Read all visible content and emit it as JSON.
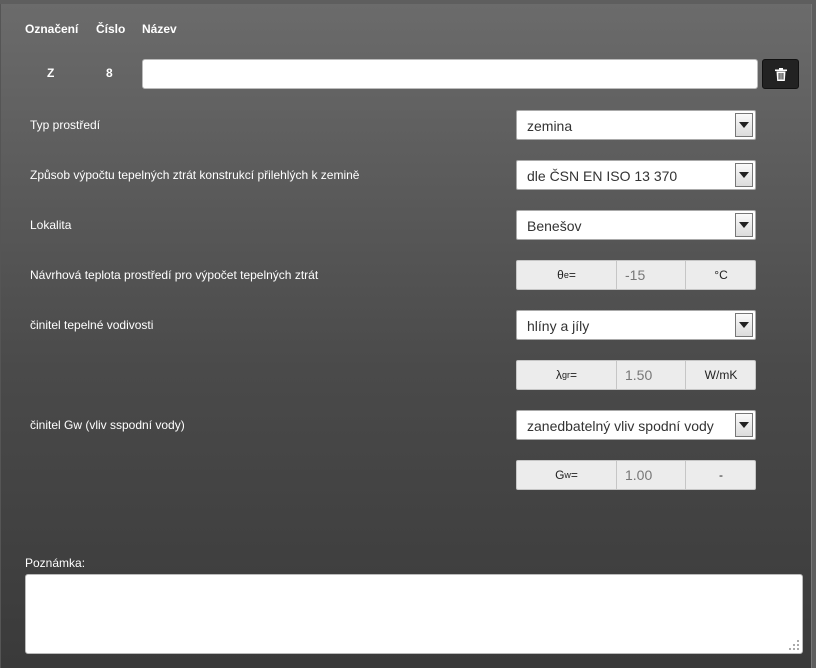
{
  "header": {
    "oznaceni": "Označení",
    "cislo": "Číslo",
    "nazev": "Název"
  },
  "row": {
    "oznaceni": "Z",
    "cislo": "8",
    "name_value": ""
  },
  "fields": {
    "typ_prostredi": {
      "label": "Typ prostředí",
      "value": "zemina"
    },
    "zpusob": {
      "label": "Způsob výpočtu tepelných ztrát konstrukcí přilehlých k zemině",
      "value": "dle ČSN EN ISO 13 370"
    },
    "lokalita": {
      "label": "Lokalita",
      "value": "Benešov"
    },
    "teplota": {
      "label": "Návrhová teplota prostředí pro výpočet tepelných ztrát",
      "symbol": "θ",
      "symbol_sub": "e",
      "symbol_eq": "=",
      "value": "-15",
      "unit": "°C"
    },
    "vodivost": {
      "label": "činitel tepelné vodivosti",
      "value": "hlíny a jíly"
    },
    "lambda": {
      "symbol": "λ",
      "symbol_sub": "gr",
      "symbol_eq": "=",
      "value": "1.50",
      "unit": "W/mK"
    },
    "gw": {
      "label": "činitel Gw (vliv sspodní vody)",
      "value": "zanedbatelný vliv spodní vody"
    },
    "gw_value": {
      "symbol": "G",
      "symbol_sub": "w",
      "symbol_eq": "=",
      "value": "1.00",
      "unit": "-"
    }
  },
  "note": {
    "label": "Poznámka:",
    "value": ""
  },
  "icons": {
    "delete": "trash-icon",
    "dropdown": "caret-down-icon",
    "resize": "resize-grip-icon"
  }
}
